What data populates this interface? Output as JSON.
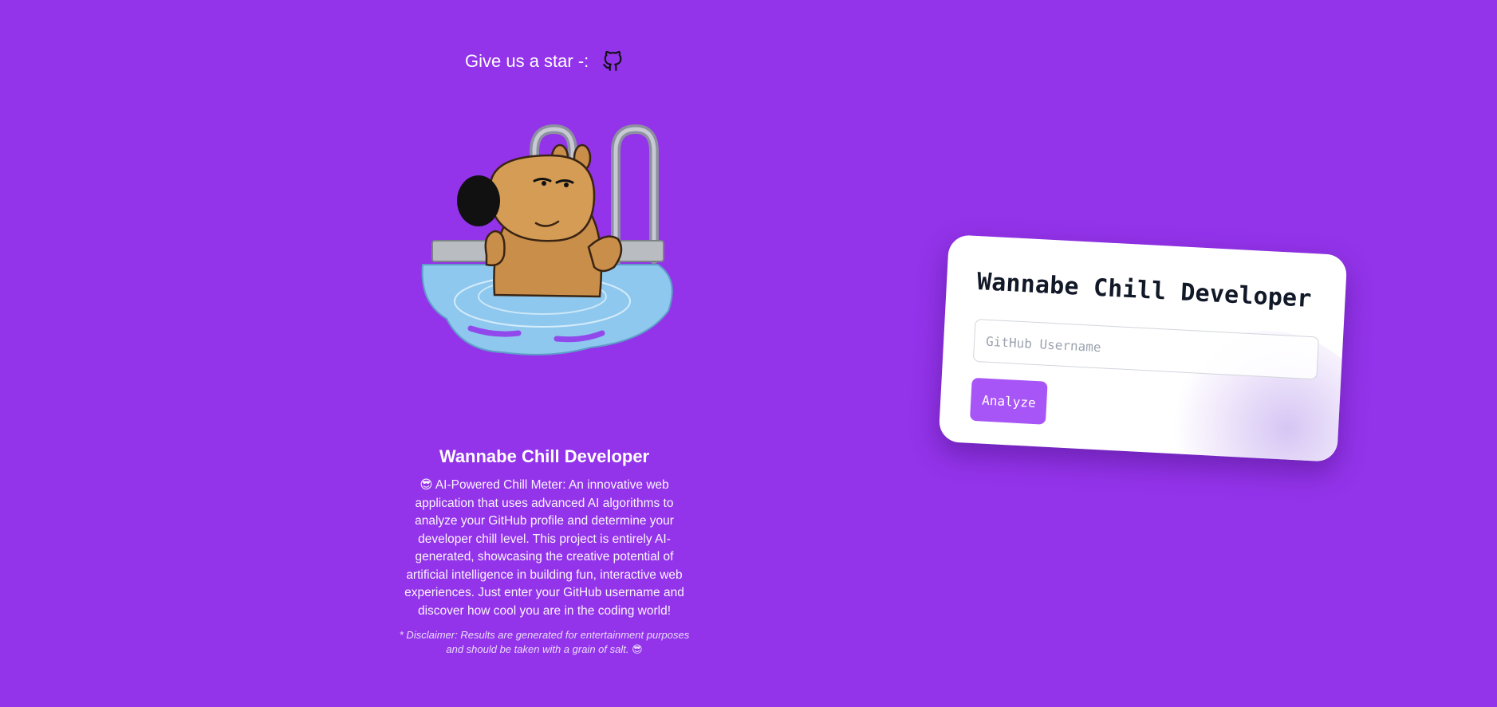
{
  "header": {
    "star_text": "Give us a star -:",
    "github_icon": "github-icon"
  },
  "mascot": {
    "icon": "capybara-in-pool-illustration"
  },
  "info": {
    "title": "Wannabe Chill Developer",
    "emoji": "😎",
    "description": "AI-Powered Chill Meter: An innovative web application that uses advanced AI algorithms to analyze your GitHub profile and determine your developer chill level. This project is entirely AI-generated, showcasing the creative potential of artificial intelligence in building fun, interactive web experiences. Just enter your GitHub username and discover how cool you are in the coding world!",
    "disclaimer": "* Disclaimer: Results are generated for entertainment purposes and should be taken with a grain of salt.",
    "disclaimer_emoji": "😎"
  },
  "card": {
    "title": "Wannabe Chill Developer",
    "input_placeholder": "GitHub Username",
    "input_value": "",
    "button_label": "Analyze"
  },
  "colors": {
    "background": "#9333ea",
    "button": "#a855f7",
    "card": "#ffffff",
    "title_text": "#111827"
  }
}
